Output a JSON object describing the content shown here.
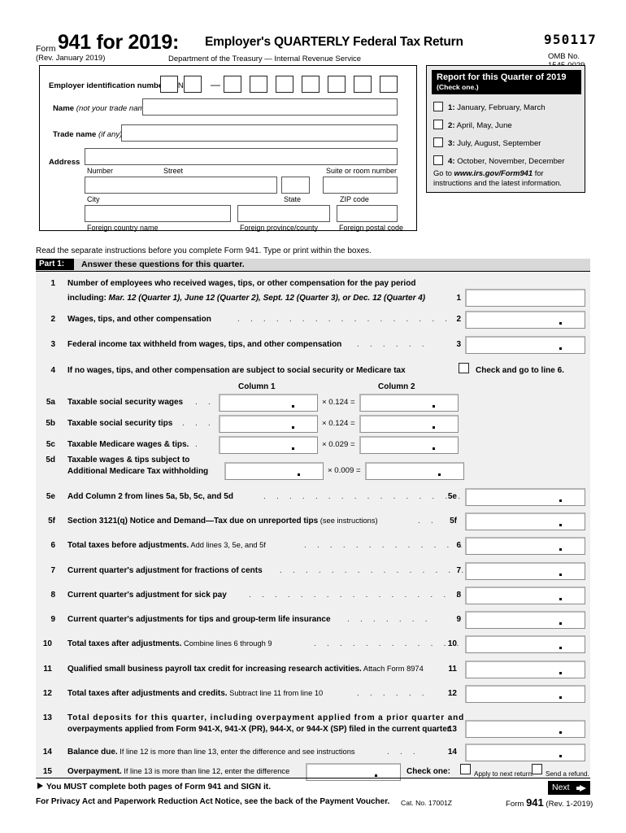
{
  "header": {
    "form_word": "Form",
    "form_number": "941 for 2019:",
    "title": "Employer's QUARTERLY Federal Tax Return",
    "revision": "(Rev. January 2019)",
    "department": "Department of the Treasury — Internal Revenue Service",
    "ocr_code": "950117",
    "omb": "OMB No. 1545-0029"
  },
  "employer": {
    "ein_label_bold": "Employer identification number ",
    "ein_label_paren": "(EIN)",
    "ein_dash": "—",
    "name_label_bold": "Name ",
    "name_label_italic": "(not your trade name)",
    "trade_label_bold": "Trade name ",
    "trade_label_italic": "(if any)",
    "address_label": "Address",
    "sub_number": "Number",
    "sub_street": "Street",
    "sub_suite": "Suite or room number",
    "sub_city": "City",
    "sub_state": "State",
    "sub_zip": "ZIP code",
    "sub_foreign_country": "Foreign country name",
    "sub_foreign_province": "Foreign province/county",
    "sub_foreign_postal": "Foreign postal code"
  },
  "quarter": {
    "heading": "Report for this Quarter of 2019",
    "subheading": "(Check one.)",
    "options": [
      {
        "num": "1:",
        "label": " January, February, March"
      },
      {
        "num": "2:",
        "label": " April, May, June"
      },
      {
        "num": "3:",
        "label": " July, August, September"
      },
      {
        "num": "4:",
        "label": " October, November, December"
      }
    ],
    "goto_pre": "Go to ",
    "goto_url": "www.irs.gov/Form941",
    "goto_post": " for instructions and the latest information."
  },
  "read_instruction": "Read the separate instructions before you complete Form 941. Type or print within the boxes.",
  "part1": {
    "tag": "Part 1:",
    "title": "Answer these questions for this quarter."
  },
  "columns": {
    "col1": "Column 1",
    "col2": "Column 2"
  },
  "lines": {
    "l1_no": "1",
    "l1_t1": "Number of employees who received wages, tips, or other compensation for the pay period",
    "l1_t2_pre": "including: ",
    "l1_t2": "Mar. 12 (Quarter 1), June 12 (Quarter 2), Sept. 12 (Quarter 3), or Dec. 12 (Quarter 4)",
    "l1_ref": "1",
    "l2_no": "2",
    "l2_t": "Wages, tips, and other compensation",
    "l2_ref": "2",
    "l3_no": "3",
    "l3_t": "Federal income tax withheld from wages, tips, and other compensation",
    "l3_ref": "3",
    "l4_no": "4",
    "l4_t": "If no wages, tips, and other compensation are subject to social security or Medicare tax",
    "l4_check": "Check and go to line 6.",
    "l5a_no": "5a",
    "l5a_t": "Taxable social security wages",
    "l5a_mult": "× 0.124 =",
    "l5b_no": "5b",
    "l5b_t": "Taxable social security tips",
    "l5b_mult": "× 0.124 =",
    "l5c_no": "5c",
    "l5c_t": "Taxable Medicare wages & tips.",
    "l5c_mult": "× 0.029 =",
    "l5d_no": "5d",
    "l5d_t1": "Taxable wages & tips subject to",
    "l5d_t2": "Additional Medicare Tax withholding",
    "l5d_mult": "× 0.009 =",
    "l5e_no": "5e",
    "l5e_t": "Add Column 2 from lines 5a, 5b, 5c, and 5d",
    "l5e_ref": "5e",
    "l5f_no": "5f",
    "l5f_t": "Section 3121(q) Notice and Demand—Tax due on unreported tips",
    "l5f_sm": "(see instructions)",
    "l5f_ref": "5f",
    "l6_no": "6",
    "l6_t": "Total taxes before adjustments.",
    "l6_sm": " Add lines 3, 5e, and 5f",
    "l6_ref": "6",
    "l7_no": "7",
    "l7_t": "Current quarter's adjustment for fractions of cents",
    "l7_ref": "7",
    "l8_no": "8",
    "l8_t": "Current quarter's adjustment for sick pay",
    "l8_ref": "8",
    "l9_no": "9",
    "l9_t": "Current quarter's adjustments for tips and group-term life insurance",
    "l9_ref": "9",
    "l10_no": "10",
    "l10_t": "Total taxes after adjustments.",
    "l10_sm": " Combine lines 6 through 9",
    "l10_ref": "10",
    "l11_no": "11",
    "l11_t": "Qualified small business payroll tax credit for increasing research activities.",
    "l11_sm": " Attach Form 8974",
    "l11_ref": "11",
    "l12_no": "12",
    "l12_t": "Total taxes after adjustments and credits.",
    "l12_sm": " Subtract line 11 from line 10",
    "l12_ref": "12",
    "l13_no": "13",
    "l13_t1": "Total deposits for this quarter, including overpayment applied from a prior quarter and",
    "l13_t2": "overpayments applied from Form 941-X, 941-X (PR), 944-X, or 944-X (SP) filed in the current quarter",
    "l13_ref": "13",
    "l14_no": "14",
    "l14_t": "Balance due.",
    "l14_sm": " If line 12 is more than line 13, enter the difference and see instructions",
    "l14_ref": "14",
    "l15_no": "15",
    "l15_t": "Overpayment.",
    "l15_sm": " If line 13 is more than line 12, enter the difference",
    "l15_check_one": "Check one:",
    "l15_opt1": "Apply to next return.",
    "l15_opt2": "Send a refund."
  },
  "leader_dots": ". . . . . . . . . . . . . . . . . . . .",
  "footer": {
    "must_complete": "You MUST complete both pages of Form 941 and SIGN it.",
    "privacy": "For Privacy Act and Paperwork Reduction Act Notice, see the back of the Payment Voucher.",
    "cat_no": "Cat. No. 17001Z",
    "form_pre": "Form ",
    "form_num": "941",
    "form_rev": " (Rev. 1-2019)",
    "next_label": "Next"
  }
}
